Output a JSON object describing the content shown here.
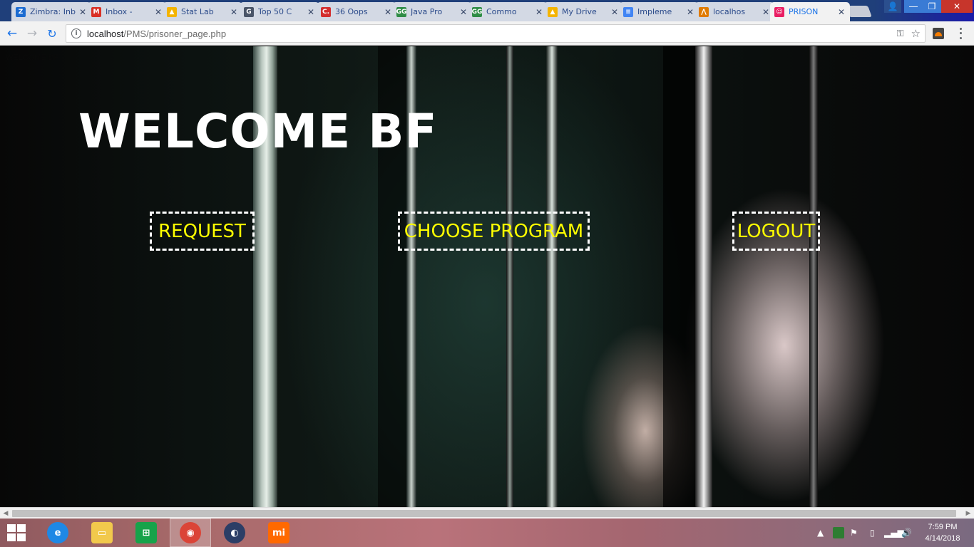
{
  "browser": {
    "tabs": [
      {
        "title": "Zimbra: Inbox",
        "icon": "zimbra-icon",
        "icon_letter": "Z",
        "icon_color": "#1b6bd1"
      },
      {
        "title": "Inbox - ",
        "icon": "gmail-icon",
        "icon_letter": "M",
        "icon_color": "#d93025"
      },
      {
        "title": "Stat Lab",
        "icon": "google-drive-icon",
        "icon_letter": "▲",
        "icon_color": "#f4b400"
      },
      {
        "title": "Top 50 C",
        "icon": "google-icon",
        "icon_letter": "G",
        "icon_color": "#4a5568"
      },
      {
        "title": "36 Oops",
        "icon": "c-site-icon",
        "icon_letter": "C.",
        "icon_color": "#d32f2f"
      },
      {
        "title": "Java Pro",
        "icon": "geeksforgeeks-icon",
        "icon_letter": "GG",
        "icon_color": "#2f8d46"
      },
      {
        "title": "Commo",
        "icon": "geeksforgeeks-icon",
        "icon_letter": "GG",
        "icon_color": "#2f8d46"
      },
      {
        "title": "My Drive",
        "icon": "google-drive-icon",
        "icon_letter": "▲",
        "icon_color": "#f4b400"
      },
      {
        "title": "Impleme",
        "icon": "google-docs-icon",
        "icon_letter": "≡",
        "icon_color": "#4285f4"
      },
      {
        "title": "localhos",
        "icon": "xampp-icon",
        "icon_letter": "⋀",
        "icon_color": "#e07b00"
      },
      {
        "title": "PRISON",
        "icon": "prison-site-icon",
        "icon_letter": "☺",
        "icon_color": "#e91e63",
        "active": true
      }
    ],
    "url_host": "localhost",
    "url_path": "/PMS/prisoner_page.php"
  },
  "page": {
    "tiny_text": "WELCOME BF",
    "welcome": "WELCOME BF",
    "nav": {
      "request": "REQUEST",
      "choose_program": "CHOOSE PROGRAM",
      "logout": "LOGOUT"
    },
    "colors": {
      "link_text": "#ffff00",
      "link_border": "#ffffff",
      "heading": "#ffffff"
    }
  },
  "taskbar": {
    "apps": [
      {
        "name": "internet-explorer",
        "label": "e",
        "color": "#1e88e5"
      },
      {
        "name": "file-explorer",
        "label": "▭",
        "color": "#f2c94c"
      },
      {
        "name": "windows-store",
        "label": "⊞",
        "color": "#16a34a"
      },
      {
        "name": "chrome",
        "label": "◉",
        "color": "#db4437",
        "active": true
      },
      {
        "name": "eclipse",
        "label": "◐",
        "color": "#2c3e66"
      },
      {
        "name": "mi",
        "label": "mi",
        "color": "#ff6900"
      }
    ],
    "time": "7:59 PM",
    "date": "4/14/2018"
  }
}
